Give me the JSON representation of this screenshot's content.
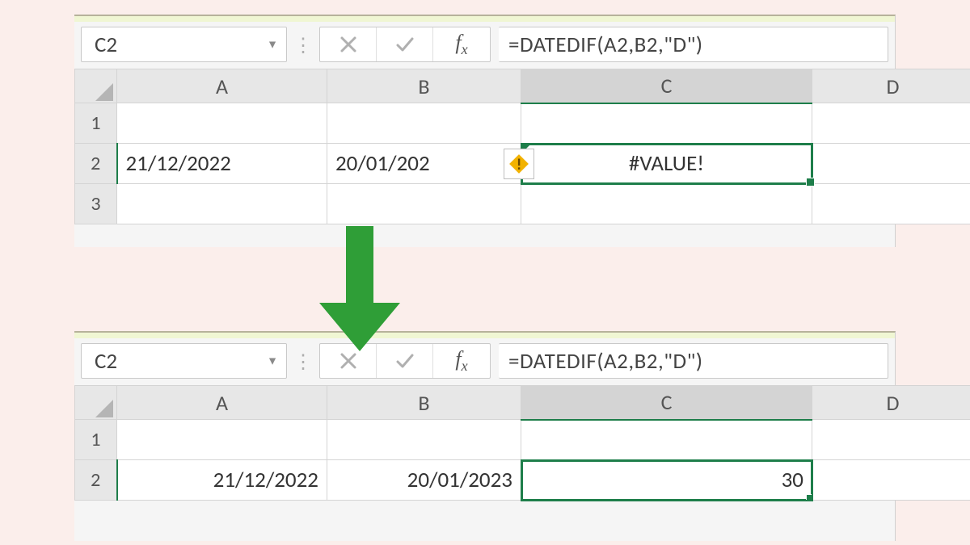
{
  "top": {
    "namebox": "C2",
    "formula": "=DATEDIF(A2,B2,\"D\")",
    "columns": [
      "A",
      "B",
      "C",
      "D"
    ],
    "rows": [
      "1",
      "2",
      "3"
    ],
    "cells": {
      "A2": "21/12/2022",
      "B2": "20/01/202",
      "C2": "#VALUE!"
    },
    "active_cell": "C2",
    "error_marker_cell": "C2",
    "warning_adjacent_to": "C2"
  },
  "bottom": {
    "namebox": "C2",
    "formula": "=DATEDIF(A2,B2,\"D\")",
    "columns": [
      "A",
      "B",
      "C",
      "D"
    ],
    "rows": [
      "1",
      "2"
    ],
    "cells": {
      "A2": "21/12/2022",
      "B2": "20/01/2023",
      "C2": "30"
    },
    "active_cell": "C2"
  },
  "icons": {
    "namebox_dropdown": "chevron-down",
    "vsep": "vertical-ellipsis",
    "cancel": "x",
    "enter": "check",
    "fx": "fx",
    "warn": "warning-diamond",
    "arrow": "down-arrow"
  },
  "colors": {
    "selection": "#1e7e4a",
    "arrow": "#2f9e37",
    "warn_fill": "#f2b200"
  }
}
